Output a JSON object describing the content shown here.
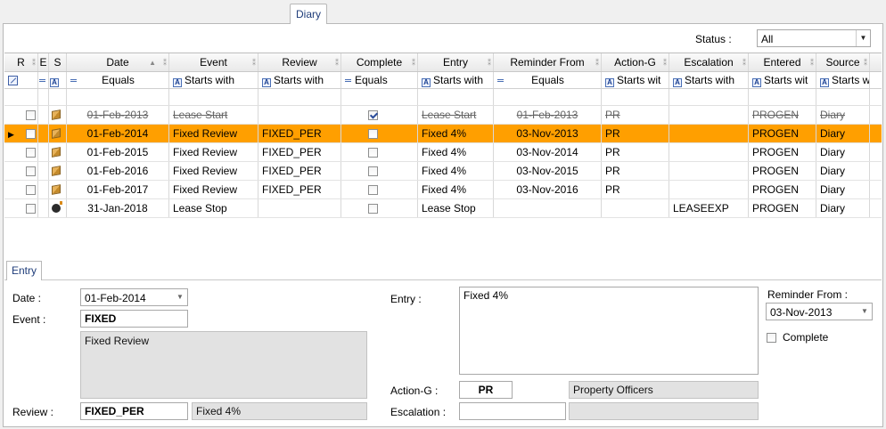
{
  "top_tab": "Diary",
  "status": {
    "label": "Status :",
    "value": "All"
  },
  "grid": {
    "columns": [
      {
        "key": "r",
        "label": "R",
        "width": 38
      },
      {
        "key": "e",
        "label": "E",
        "width": 12
      },
      {
        "key": "s",
        "label": "S",
        "width": 20
      },
      {
        "key": "date",
        "label": "Date",
        "width": 115
      },
      {
        "key": "event",
        "label": "Event",
        "width": 100
      },
      {
        "key": "review",
        "label": "Review",
        "width": 93
      },
      {
        "key": "complete",
        "label": "Complete",
        "width": 86
      },
      {
        "key": "entry",
        "label": "Entry",
        "width": 85
      },
      {
        "key": "reminder",
        "label": "Reminder From",
        "width": 121
      },
      {
        "key": "action",
        "label": "Action-G",
        "width": 76
      },
      {
        "key": "escalation",
        "label": "Escalation",
        "width": 89
      },
      {
        "key": "entered",
        "label": "Entered",
        "width": 76
      },
      {
        "key": "source",
        "label": "Source",
        "width": 60
      }
    ],
    "filters": {
      "date": "Equals",
      "event": "Starts with",
      "review": "Starts with",
      "complete": "Equals",
      "entry": "Starts with",
      "reminder": "Equals",
      "action": "Starts wit",
      "escalation": "Starts with",
      "entered": "Starts wit",
      "source": "Starts w"
    },
    "rows": [
      {
        "struck": true,
        "selected": false,
        "icon": "box",
        "checked_r": false,
        "date": "01-Feb-2013",
        "event": "Lease Start",
        "review": "",
        "complete": true,
        "entry": "Lease Start",
        "reminder": "01-Feb-2013",
        "action": "PR",
        "escalation": "",
        "entered": "PROGEN",
        "source": "Diary"
      },
      {
        "struck": false,
        "selected": true,
        "icon": "box",
        "checked_r": false,
        "date": "01-Feb-2014",
        "event": "Fixed Review",
        "review": "FIXED_PER",
        "complete": false,
        "entry": "Fixed 4%",
        "reminder": "03-Nov-2013",
        "action": "PR",
        "escalation": "",
        "entered": "PROGEN",
        "source": "Diary"
      },
      {
        "struck": false,
        "selected": false,
        "icon": "box",
        "checked_r": false,
        "date": "01-Feb-2015",
        "event": "Fixed Review",
        "review": "FIXED_PER",
        "complete": false,
        "entry": "Fixed 4%",
        "reminder": "03-Nov-2014",
        "action": "PR",
        "escalation": "",
        "entered": "PROGEN",
        "source": "Diary"
      },
      {
        "struck": false,
        "selected": false,
        "icon": "box",
        "checked_r": false,
        "date": "01-Feb-2016",
        "event": "Fixed Review",
        "review": "FIXED_PER",
        "complete": false,
        "entry": "Fixed 4%",
        "reminder": "03-Nov-2015",
        "action": "PR",
        "escalation": "",
        "entered": "PROGEN",
        "source": "Diary"
      },
      {
        "struck": false,
        "selected": false,
        "icon": "box",
        "checked_r": false,
        "date": "01-Feb-2017",
        "event": "Fixed Review",
        "review": "FIXED_PER",
        "complete": false,
        "entry": "Fixed 4%",
        "reminder": "03-Nov-2016",
        "action": "PR",
        "escalation": "",
        "entered": "PROGEN",
        "source": "Diary"
      },
      {
        "struck": false,
        "selected": false,
        "icon": "bomb",
        "checked_r": false,
        "date": "31-Jan-2018",
        "event": "Lease Stop",
        "review": "",
        "complete": false,
        "entry": "Lease Stop",
        "reminder": "",
        "action": "",
        "escalation": "LEASEEXP",
        "entered": "PROGEN",
        "source": "Diary"
      }
    ]
  },
  "entry_tab": "Entry",
  "entry_form": {
    "date_label": "Date :",
    "date_value": "01-Feb-2014",
    "event_label": "Event :",
    "event_code": "FIXED",
    "event_desc": "Fixed Review",
    "review_label": "Review :",
    "review_code": "FIXED_PER",
    "review_desc": "Fixed 4%",
    "entry_label": "Entry :",
    "entry_text": "Fixed 4%",
    "action_label": "Action-G :",
    "action_code": "PR",
    "action_desc": "Property Officers",
    "escalation_label": "Escalation :",
    "escalation_code": "",
    "escalation_desc": "",
    "reminder_label": "Reminder From :",
    "reminder_value": "03-Nov-2013",
    "complete_label": "Complete"
  },
  "colors": {
    "selected_row": "#ff9f00",
    "tab_text": "#1f3d7a"
  }
}
